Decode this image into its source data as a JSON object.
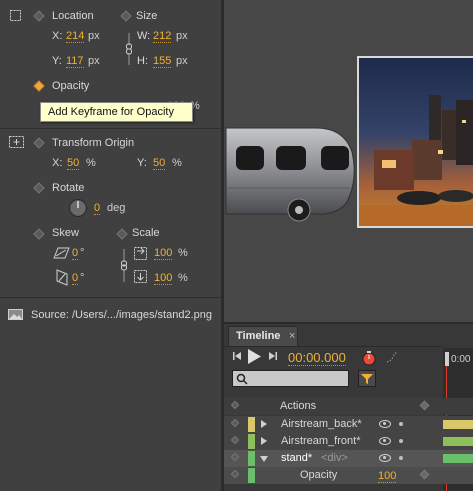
{
  "properties": {
    "location": {
      "label": "Location",
      "x_label": "X:",
      "x_value": "214",
      "x_unit": "px",
      "y_label": "Y:",
      "y_value": "117",
      "y_unit": "px"
    },
    "size": {
      "label": "Size",
      "w_label": "W:",
      "w_value": "212",
      "w_unit": "px",
      "h_label": "H:",
      "h_value": "155",
      "h_unit": "px"
    },
    "opacity": {
      "label": "Opacity",
      "value": "100",
      "unit": "%"
    },
    "tooltip": "Add Keyframe for Opacity",
    "transform_origin": {
      "label": "Transform Origin",
      "x_label": "X:",
      "x_value": "50",
      "x_unit": "%",
      "y_label": "Y:",
      "y_value": "50",
      "y_unit": "%"
    },
    "rotate": {
      "label": "Rotate",
      "value": "0",
      "unit": "deg"
    },
    "skew": {
      "label": "Skew",
      "x_value": "0",
      "x_unit": "°",
      "y_value": "0",
      "y_unit": "°"
    },
    "scale": {
      "label": "Scale",
      "x_value": "100",
      "x_unit": "%",
      "y_value": "100",
      "y_unit": "%"
    },
    "source": "Source: /Users/.../images/stand2.png"
  },
  "timeline": {
    "tab_label": "Timeline",
    "close": "×",
    "timecode": "00:00.000",
    "ruler_label": "0:00",
    "rows": [
      {
        "label": "Actions",
        "color": ""
      },
      {
        "label": "Airstream_back*",
        "color": "#d8c86a"
      },
      {
        "label": "Airstream_front*",
        "color": "#8fbf5a"
      },
      {
        "label": "stand*",
        "sub": "<div>",
        "color": "#6bbf6b"
      },
      {
        "label": "Opacity",
        "value": "100"
      }
    ]
  },
  "colors": {
    "accent": "#f0b135",
    "keyframe": "#f0a83a",
    "tooltip_bg": "#ffffcc"
  }
}
